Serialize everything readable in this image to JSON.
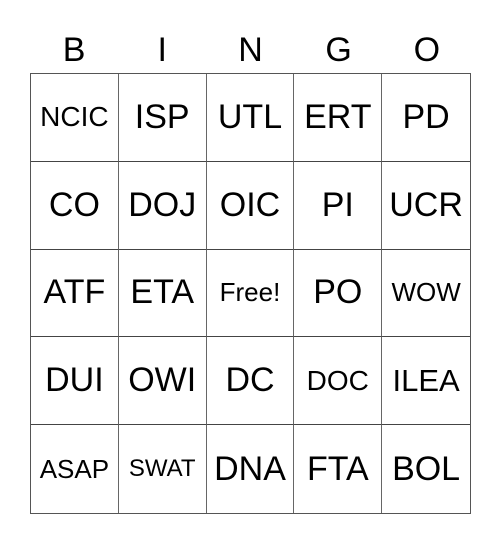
{
  "header": [
    "B",
    "I",
    "N",
    "G",
    "O"
  ],
  "cells": [
    [
      "NCIC",
      "ISP",
      "UTL",
      "ERT",
      "PD"
    ],
    [
      "CO",
      "DOJ",
      "OIC",
      "PI",
      "UCR"
    ],
    [
      "ATF",
      "ETA",
      "Free!",
      "PO",
      "WOW"
    ],
    [
      "DUI",
      "OWI",
      "DC",
      "DOC",
      "ILEA"
    ],
    [
      "ASAP",
      "SWAT",
      "DNA",
      "FTA",
      "BOL"
    ]
  ]
}
